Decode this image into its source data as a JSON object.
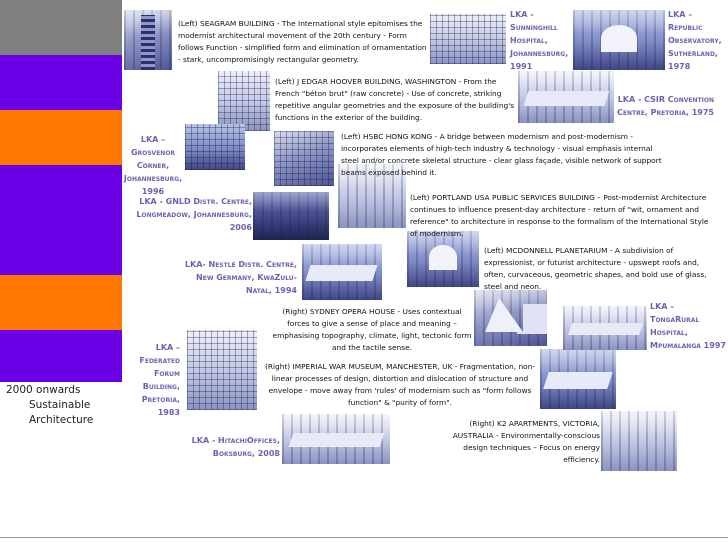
{
  "timeline": {
    "stripe_colors": [
      "#7f7f7f",
      "#6b00e6",
      "#ff7700",
      "#6b00e6",
      "#ff7700",
      "#6b00e6",
      "#7f7f7f",
      "#ffffff"
    ],
    "period_label": "2000 onwards",
    "period_line2": "Sustainable",
    "period_line3": "Architecture"
  },
  "captions": {
    "seagram": "(Left) SEAGRAM BUILDING - The International style epitomises the modernist architectural movement of the 20th century - Form follows Function  - simplified form and elimination of ornamentation - stark, uncompromisingly rectangular geometry.",
    "hoover": "(Left) J EDGAR HOOVER BUILDING, WASHINGTON - From the French \"béton brut\" (raw concrete) - Use of concrete, striking repetitive angular geometries and the exposure of the building's functions in the exterior of the building.",
    "hsbc": "(Left) HSBC HONG KONG - A bridge between modernism and post-modernism - incorporates elements of high-tech industry & technology - visual emphasis internal steel and/or concrete skeletal structure - clear glass façade, visible network of support beams exposed behind it.",
    "portland": "(Left) PORTLAND USA PUBLIC SERVICES BUILDING – Post-modernist Architecture continues to influence present-day architecture - return of \"wit, ornament and reference\" to architecture in response to the formalism of the International Style of modernism.",
    "mcdonnell": "(Left) MCDONNELL PLANETARIUM - A subdivision of expressionist, or futurist architecture - upswept roofs and, often, curvaceous, geometric shapes, and bold use of glass, steel and neon.",
    "sydney": "(Right) SYDNEY OPERA HOUSE -  Uses contextual forces to give a sense of place and meaning – emphasising topography, climate, light, tectonic form and the tactile sense.",
    "imperial": "(Right) IMPERIAL WAR MUSEUM, MANCHESTER, UK -  Fragmentation, non-linear processes of design,  distortion and dislocation of structure and envelope - move away from 'rules' of modernism such as \"form follows function\" & \"purity of form\".",
    "k2": "(Right) K2 APARTMENTS, VICTORIA, AUSTRALIA - Environmentally-conscious design techniques – Focus on energy efficiency."
  },
  "lka_labels": {
    "sunninghill": "LKA - Sunninghill Hospital, Johannesburg, 1991",
    "observatory": "LKA – Republic Observatory, Sutherland, 1978",
    "csir": "LKA - CSIR Convention Centre, Pretoria, 1975",
    "grosvenor": "LKA – Grosvenor Corner, Johannesburg, 1996",
    "gnld": "LKA - GNLD Distr. Centre, Longmeadow, Johannesburg, 2006",
    "nestle": "LKA-  Nestlé Distr. Centre, New Germany, KwaZulu-Natal, 1994",
    "tongarural": "LKA – TongaRural Hospital, Mpumalanga 1997",
    "federated": "LKA – Federated Forum Building, Pretoria, 1983",
    "hitachi": "LKA - HitachiOffices, Boksburg, 2008"
  }
}
